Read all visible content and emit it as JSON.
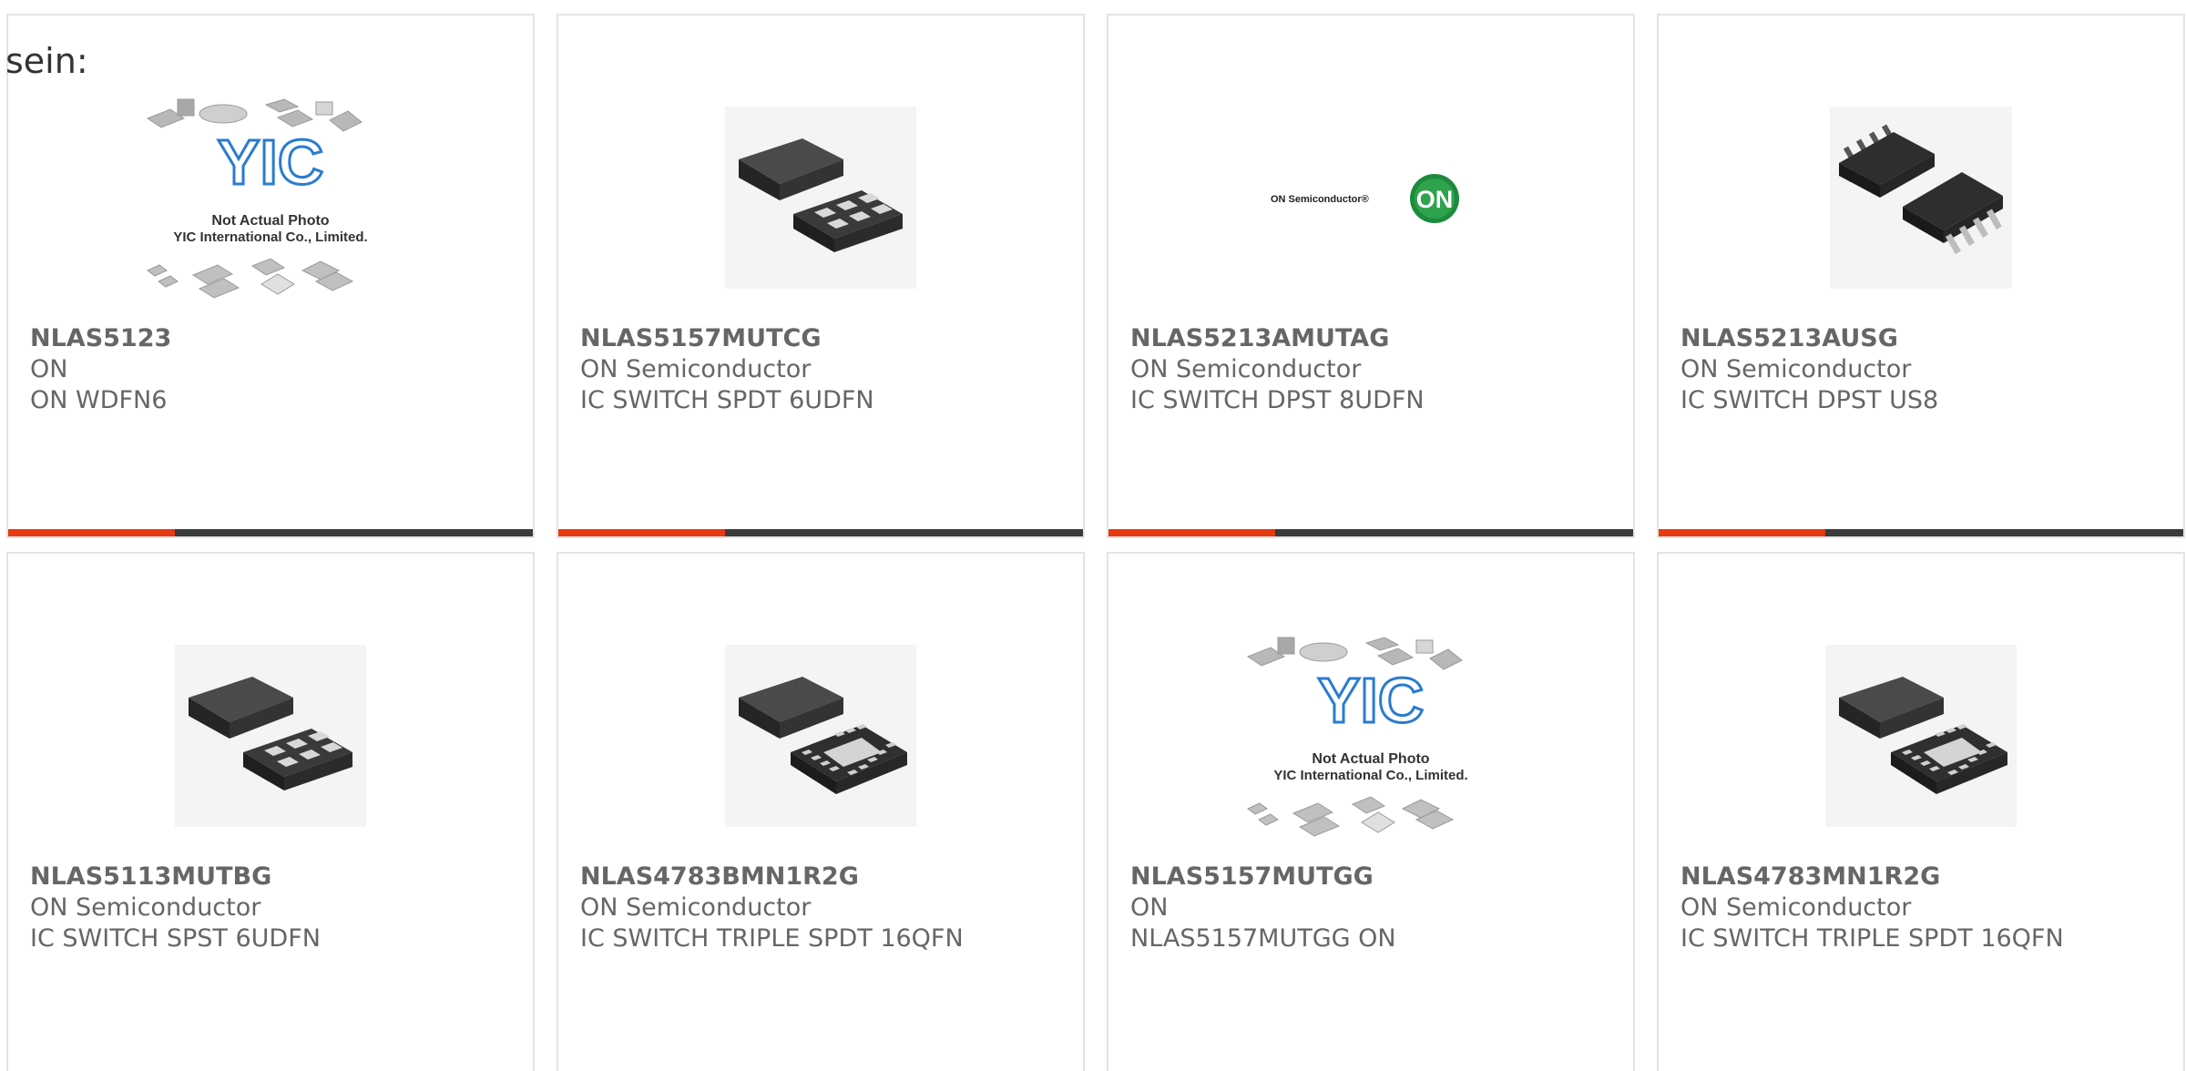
{
  "intro_text": "sein:",
  "colors": {
    "accent": "#e63a12",
    "bar": "#3b3b3b",
    "text": "#666666",
    "border": "#e4e4e4"
  },
  "products": [
    {
      "part": "NLAS5123",
      "manufacturer": "ON",
      "description": "ON WDFN6",
      "image": "placeholder-photo",
      "placeholder_caption1": "Not Actual Photo",
      "placeholder_caption2": "YIC International Co., Limited.",
      "placeholder_logo": "YIC"
    },
    {
      "part": "NLAS5157MUTCG",
      "manufacturer": "ON Semiconductor",
      "description": "IC SWITCH SPDT 6UDFN",
      "image": "udfn6-chip"
    },
    {
      "part": "NLAS5213AMUTAG",
      "manufacturer": "ON Semiconductor",
      "description": "IC SWITCH DPST 8UDFN",
      "image": "on-semiconductor-logo",
      "logo_text": "ON Semiconductor®",
      "logo_badge": "ON"
    },
    {
      "part": "NLAS5213AUSG",
      "manufacturer": "ON Semiconductor",
      "description": "IC SWITCH DPST US8",
      "image": "us8-chip"
    },
    {
      "part": "NLAS5113MUTBG",
      "manufacturer": "ON Semiconductor",
      "description": "IC SWITCH SPST 6UDFN",
      "image": "udfn6-chip"
    },
    {
      "part": "NLAS4783BMN1R2G",
      "manufacturer": "ON Semiconductor",
      "description": "IC SWITCH TRIPLE SPDT 16QFN",
      "image": "qfn16-chip"
    },
    {
      "part": "NLAS5157MUTGG",
      "manufacturer": "ON",
      "description": "NLAS5157MUTGG ON",
      "image": "placeholder-photo",
      "placeholder_caption1": "Not Actual Photo",
      "placeholder_caption2": "YIC International Co., Limited.",
      "placeholder_logo": "YIC"
    },
    {
      "part": "NLAS4783MN1R2G",
      "manufacturer": "ON Semiconductor",
      "description": "IC SWITCH TRIPLE SPDT 16QFN",
      "image": "qfn16-chip"
    }
  ]
}
